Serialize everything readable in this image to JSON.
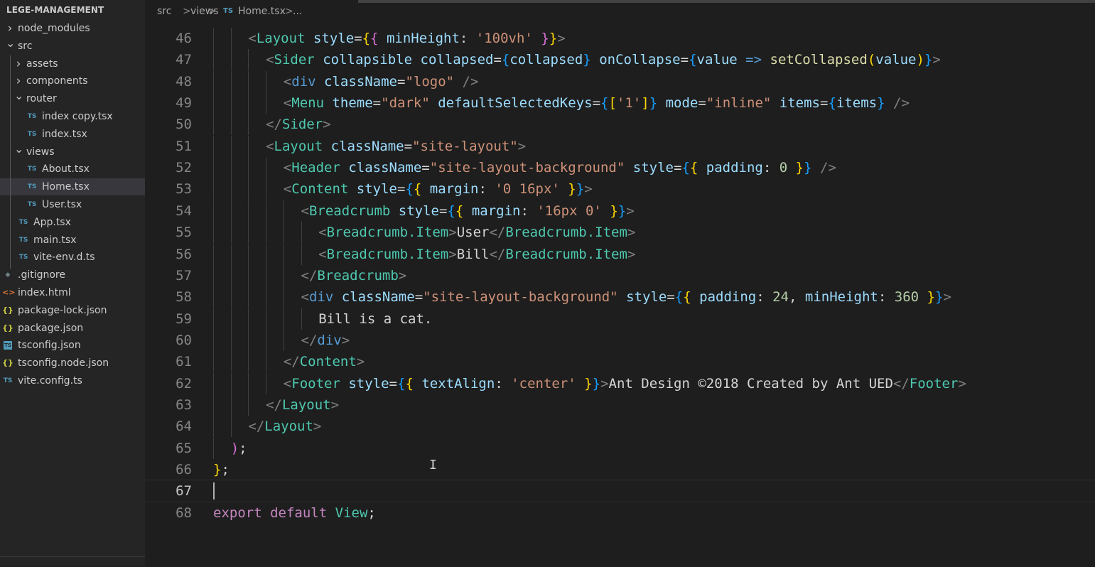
{
  "sidebar": {
    "title": "LEGE-MANAGEMENT",
    "items": [
      {
        "label": "node_modules",
        "type": "folder",
        "expanded": false,
        "depth": 0,
        "icon": "chevron-right-icon"
      },
      {
        "label": "src",
        "type": "folder",
        "expanded": true,
        "depth": 0,
        "icon": "chevron-down-icon"
      },
      {
        "label": "assets",
        "type": "folder",
        "expanded": false,
        "depth": 1,
        "icon": "chevron-right-icon"
      },
      {
        "label": "components",
        "type": "folder",
        "expanded": false,
        "depth": 1,
        "icon": "chevron-right-icon"
      },
      {
        "label": "router",
        "type": "folder",
        "expanded": true,
        "depth": 1,
        "icon": "chevron-down-icon"
      },
      {
        "label": "index copy.tsx",
        "type": "ts",
        "depth": 2,
        "badge": "TS"
      },
      {
        "label": "index.tsx",
        "type": "ts",
        "depth": 2,
        "badge": "TS"
      },
      {
        "label": "views",
        "type": "folder",
        "expanded": true,
        "depth": 1,
        "icon": "chevron-down-icon"
      },
      {
        "label": "About.tsx",
        "type": "ts",
        "depth": 2,
        "badge": "TS"
      },
      {
        "label": "Home.tsx",
        "type": "ts",
        "depth": 2,
        "badge": "TS",
        "selected": true
      },
      {
        "label": "User.tsx",
        "type": "ts",
        "depth": 2,
        "badge": "TS"
      },
      {
        "label": "App.tsx",
        "type": "ts",
        "depth": 1,
        "badge": "TS"
      },
      {
        "label": "main.tsx",
        "type": "ts",
        "depth": 1,
        "badge": "TS"
      },
      {
        "label": "vite-env.d.ts",
        "type": "ts",
        "depth": 1,
        "badge": "TS"
      },
      {
        "label": ".gitignore",
        "type": "git",
        "depth": 0,
        "badge": "◆"
      },
      {
        "label": "index.html",
        "type": "html",
        "depth": 0,
        "badge": "<>"
      },
      {
        "label": "package-lock.json",
        "type": "json",
        "depth": 0,
        "badge": "{}"
      },
      {
        "label": "package.json",
        "type": "json",
        "depth": 0,
        "badge": "{}"
      },
      {
        "label": "tsconfig.json",
        "type": "tsconfig",
        "depth": 0,
        "badge": "TS"
      },
      {
        "label": "tsconfig.node.json",
        "type": "json",
        "depth": 0,
        "badge": "{}"
      },
      {
        "label": "vite.config.ts",
        "type": "ts",
        "depth": 0,
        "badge": "TS"
      }
    ]
  },
  "breadcrumb": {
    "parts": [
      "src",
      ">",
      "views",
      ">",
      "TS",
      "Home.tsx",
      ">",
      "..."
    ]
  },
  "editor": {
    "lines": [
      {
        "n": "46",
        "tokens": [
          [
            "t-punc",
            "<"
          ],
          [
            "t-tag",
            "Layout"
          ],
          [
            "t-txt",
            " "
          ],
          [
            "t-attr",
            "style"
          ],
          [
            "t-txt",
            "="
          ],
          [
            "t-b1",
            "{"
          ],
          [
            "t-b2",
            "{"
          ],
          [
            "t-txt",
            " "
          ],
          [
            "t-attr",
            "minHeight"
          ],
          [
            "t-txt",
            ": "
          ],
          [
            "t-str",
            "'100vh'"
          ],
          [
            "t-txt",
            " "
          ],
          [
            "t-b2",
            "}"
          ],
          [
            "t-b1",
            "}"
          ],
          [
            "t-punc",
            ">"
          ]
        ],
        "indent": 2
      },
      {
        "n": "47",
        "tokens": [
          [
            "t-punc",
            "<"
          ],
          [
            "t-tag",
            "Sider"
          ],
          [
            "t-txt",
            " "
          ],
          [
            "t-attr",
            "collapsible"
          ],
          [
            "t-txt",
            " "
          ],
          [
            "t-attr",
            "collapsed"
          ],
          [
            "t-txt",
            "="
          ],
          [
            "t-b3",
            "{"
          ],
          [
            "t-var",
            "collapsed"
          ],
          [
            "t-b3",
            "}"
          ],
          [
            "t-txt",
            " "
          ],
          [
            "t-attr",
            "onCollapse"
          ],
          [
            "t-txt",
            "="
          ],
          [
            "t-b3",
            "{"
          ],
          [
            "t-var",
            "value"
          ],
          [
            "t-txt",
            " "
          ],
          [
            "t-op",
            "=>"
          ],
          [
            "t-txt",
            " "
          ],
          [
            "t-fn",
            "setCollapsed"
          ],
          [
            "t-b1",
            "("
          ],
          [
            "t-var",
            "value"
          ],
          [
            "t-b1",
            ")"
          ],
          [
            "t-b3",
            "}"
          ],
          [
            "t-punc",
            ">"
          ]
        ],
        "indent": 3
      },
      {
        "n": "48",
        "tokens": [
          [
            "t-punc",
            "<"
          ],
          [
            "t-op",
            "div"
          ],
          [
            "t-txt",
            " "
          ],
          [
            "t-attr",
            "className"
          ],
          [
            "t-txt",
            "="
          ],
          [
            "t-str",
            "\"logo\""
          ],
          [
            "t-txt",
            " "
          ],
          [
            "t-punc",
            "/>"
          ]
        ],
        "indent": 4
      },
      {
        "n": "49",
        "tokens": [
          [
            "t-punc",
            "<"
          ],
          [
            "t-tag",
            "Menu"
          ],
          [
            "t-txt",
            " "
          ],
          [
            "t-attr",
            "theme"
          ],
          [
            "t-txt",
            "="
          ],
          [
            "t-str",
            "\"dark\""
          ],
          [
            "t-txt",
            " "
          ],
          [
            "t-attr",
            "defaultSelectedKeys"
          ],
          [
            "t-txt",
            "="
          ],
          [
            "t-b3",
            "{"
          ],
          [
            "t-b1",
            "["
          ],
          [
            "t-str",
            "'1'"
          ],
          [
            "t-b1",
            "]"
          ],
          [
            "t-b3",
            "}"
          ],
          [
            "t-txt",
            " "
          ],
          [
            "t-attr",
            "mode"
          ],
          [
            "t-txt",
            "="
          ],
          [
            "t-str",
            "\"inline\""
          ],
          [
            "t-txt",
            " "
          ],
          [
            "t-attr",
            "items"
          ],
          [
            "t-txt",
            "="
          ],
          [
            "t-b3",
            "{"
          ],
          [
            "t-var",
            "items"
          ],
          [
            "t-b3",
            "}"
          ],
          [
            "t-txt",
            " "
          ],
          [
            "t-punc",
            "/>"
          ]
        ],
        "indent": 4
      },
      {
        "n": "50",
        "tokens": [
          [
            "t-punc",
            "</"
          ],
          [
            "t-tag",
            "Sider"
          ],
          [
            "t-punc",
            ">"
          ]
        ],
        "indent": 3
      },
      {
        "n": "51",
        "tokens": [
          [
            "t-punc",
            "<"
          ],
          [
            "t-tag",
            "Layout"
          ],
          [
            "t-txt",
            " "
          ],
          [
            "t-attr",
            "className"
          ],
          [
            "t-txt",
            "="
          ],
          [
            "t-str",
            "\"site-layout\""
          ],
          [
            "t-punc",
            ">"
          ]
        ],
        "indent": 3
      },
      {
        "n": "52",
        "tokens": [
          [
            "t-punc",
            "<"
          ],
          [
            "t-tag",
            "Header"
          ],
          [
            "t-txt",
            " "
          ],
          [
            "t-attr",
            "className"
          ],
          [
            "t-txt",
            "="
          ],
          [
            "t-str",
            "\"site-layout-background\""
          ],
          [
            "t-txt",
            " "
          ],
          [
            "t-attr",
            "style"
          ],
          [
            "t-txt",
            "="
          ],
          [
            "t-b3",
            "{"
          ],
          [
            "t-b1",
            "{"
          ],
          [
            "t-txt",
            " "
          ],
          [
            "t-attr",
            "padding"
          ],
          [
            "t-txt",
            ": "
          ],
          [
            "t-num",
            "0"
          ],
          [
            "t-txt",
            " "
          ],
          [
            "t-b1",
            "}"
          ],
          [
            "t-b3",
            "}"
          ],
          [
            "t-txt",
            " "
          ],
          [
            "t-punc",
            "/>"
          ]
        ],
        "indent": 4
      },
      {
        "n": "53",
        "tokens": [
          [
            "t-punc",
            "<"
          ],
          [
            "t-tag",
            "Content"
          ],
          [
            "t-txt",
            " "
          ],
          [
            "t-attr",
            "style"
          ],
          [
            "t-txt",
            "="
          ],
          [
            "t-b3",
            "{"
          ],
          [
            "t-b1",
            "{"
          ],
          [
            "t-txt",
            " "
          ],
          [
            "t-attr",
            "margin"
          ],
          [
            "t-txt",
            ": "
          ],
          [
            "t-str",
            "'0 16px'"
          ],
          [
            "t-txt",
            " "
          ],
          [
            "t-b1",
            "}"
          ],
          [
            "t-b3",
            "}"
          ],
          [
            "t-punc",
            ">"
          ]
        ],
        "indent": 4
      },
      {
        "n": "54",
        "tokens": [
          [
            "t-punc",
            "<"
          ],
          [
            "t-tag",
            "Breadcrumb"
          ],
          [
            "t-txt",
            " "
          ],
          [
            "t-attr",
            "style"
          ],
          [
            "t-txt",
            "="
          ],
          [
            "t-b3",
            "{"
          ],
          [
            "t-b1",
            "{"
          ],
          [
            "t-txt",
            " "
          ],
          [
            "t-attr",
            "margin"
          ],
          [
            "t-txt",
            ": "
          ],
          [
            "t-str",
            "'16px 0'"
          ],
          [
            "t-txt",
            " "
          ],
          [
            "t-b1",
            "}"
          ],
          [
            "t-b3",
            "}"
          ],
          [
            "t-punc",
            ">"
          ]
        ],
        "indent": 5
      },
      {
        "n": "55",
        "tokens": [
          [
            "t-punc",
            "<"
          ],
          [
            "t-tag",
            "Breadcrumb.Item"
          ],
          [
            "t-punc",
            ">"
          ],
          [
            "t-txt",
            "User"
          ],
          [
            "t-punc",
            "</"
          ],
          [
            "t-tag",
            "Breadcrumb.Item"
          ],
          [
            "t-punc",
            ">"
          ]
        ],
        "indent": 6
      },
      {
        "n": "56",
        "tokens": [
          [
            "t-punc",
            "<"
          ],
          [
            "t-tag",
            "Breadcrumb.Item"
          ],
          [
            "t-punc",
            ">"
          ],
          [
            "t-txt",
            "Bill"
          ],
          [
            "t-punc",
            "</"
          ],
          [
            "t-tag",
            "Breadcrumb.Item"
          ],
          [
            "t-punc",
            ">"
          ]
        ],
        "indent": 6
      },
      {
        "n": "57",
        "tokens": [
          [
            "t-punc",
            "</"
          ],
          [
            "t-tag",
            "Breadcrumb"
          ],
          [
            "t-punc",
            ">"
          ]
        ],
        "indent": 5
      },
      {
        "n": "58",
        "tokens": [
          [
            "t-punc",
            "<"
          ],
          [
            "t-op",
            "div"
          ],
          [
            "t-txt",
            " "
          ],
          [
            "t-attr",
            "className"
          ],
          [
            "t-txt",
            "="
          ],
          [
            "t-str",
            "\"site-layout-background\""
          ],
          [
            "t-txt",
            " "
          ],
          [
            "t-attr",
            "style"
          ],
          [
            "t-txt",
            "="
          ],
          [
            "t-b3",
            "{"
          ],
          [
            "t-b1",
            "{"
          ],
          [
            "t-txt",
            " "
          ],
          [
            "t-attr",
            "padding"
          ],
          [
            "t-txt",
            ": "
          ],
          [
            "t-num",
            "24"
          ],
          [
            "t-txt",
            ", "
          ],
          [
            "t-attr",
            "minHeight"
          ],
          [
            "t-txt",
            ": "
          ],
          [
            "t-num",
            "360"
          ],
          [
            "t-txt",
            " "
          ],
          [
            "t-b1",
            "}"
          ],
          [
            "t-b3",
            "}"
          ],
          [
            "t-punc",
            ">"
          ]
        ],
        "indent": 5
      },
      {
        "n": "59",
        "tokens": [
          [
            "t-txt",
            "Bill is a cat."
          ]
        ],
        "indent": 6
      },
      {
        "n": "60",
        "tokens": [
          [
            "t-punc",
            "</"
          ],
          [
            "t-op",
            "div"
          ],
          [
            "t-punc",
            ">"
          ]
        ],
        "indent": 5
      },
      {
        "n": "61",
        "tokens": [
          [
            "t-punc",
            "</"
          ],
          [
            "t-tag",
            "Content"
          ],
          [
            "t-punc",
            ">"
          ]
        ],
        "indent": 4
      },
      {
        "n": "62",
        "tokens": [
          [
            "t-punc",
            "<"
          ],
          [
            "t-tag",
            "Footer"
          ],
          [
            "t-txt",
            " "
          ],
          [
            "t-attr",
            "style"
          ],
          [
            "t-txt",
            "="
          ],
          [
            "t-b3",
            "{"
          ],
          [
            "t-b1",
            "{"
          ],
          [
            "t-txt",
            " "
          ],
          [
            "t-attr",
            "textAlign"
          ],
          [
            "t-txt",
            ": "
          ],
          [
            "t-str",
            "'center'"
          ],
          [
            "t-txt",
            " "
          ],
          [
            "t-b1",
            "}"
          ],
          [
            "t-b3",
            "}"
          ],
          [
            "t-punc",
            ">"
          ],
          [
            "t-txt",
            "Ant Design ©2018 Created by Ant UED"
          ],
          [
            "t-punc",
            "</"
          ],
          [
            "t-tag",
            "Footer"
          ],
          [
            "t-punc",
            ">"
          ]
        ],
        "indent": 4
      },
      {
        "n": "63",
        "tokens": [
          [
            "t-punc",
            "</"
          ],
          [
            "t-tag",
            "Layout"
          ],
          [
            "t-punc",
            ">"
          ]
        ],
        "indent": 3
      },
      {
        "n": "64",
        "tokens": [
          [
            "t-punc",
            "</"
          ],
          [
            "t-tag",
            "Layout"
          ],
          [
            "t-punc",
            ">"
          ]
        ],
        "indent": 2
      },
      {
        "n": "65",
        "tokens": [
          [
            "t-b2",
            ")"
          ],
          [
            "t-txt",
            ";"
          ]
        ],
        "indent": 1
      },
      {
        "n": "66",
        "tokens": [
          [
            "t-b1",
            "}"
          ],
          [
            "t-txt",
            ";"
          ]
        ],
        "indent": 0
      },
      {
        "n": "67",
        "tokens": [],
        "indent": 0,
        "current": true
      },
      {
        "n": "68",
        "tokens": [
          [
            "t-kw",
            "export"
          ],
          [
            "t-txt",
            " "
          ],
          [
            "t-kw",
            "default"
          ],
          [
            "t-txt",
            " "
          ],
          [
            "t-comp",
            "View"
          ],
          [
            "t-txt",
            ";"
          ]
        ],
        "indent": 0
      }
    ]
  },
  "colors": {
    "editor_bg": "#1e1e1e",
    "sidebar_bg": "#252526",
    "selected_bg": "#37373d",
    "ts_badge": "#519aba",
    "json_badge": "#cbcb41",
    "html_badge": "#e37933"
  }
}
